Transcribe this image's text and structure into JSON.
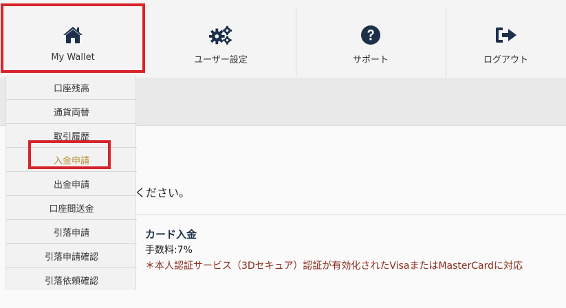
{
  "nav": {
    "items": [
      {
        "label": "My Wallet",
        "icon": "home-icon"
      },
      {
        "label": "ユーザー設定",
        "icon": "gears-icon"
      },
      {
        "label": "サポート",
        "icon": "question-icon"
      },
      {
        "label": "ログアウト",
        "icon": "logout-icon"
      }
    ]
  },
  "dropdown": {
    "items": [
      {
        "label": "口座残高"
      },
      {
        "label": "通貨両替"
      },
      {
        "label": "取引履歴"
      },
      {
        "label": "入金申請"
      },
      {
        "label": "出金申請"
      },
      {
        "label": "口座間送金"
      },
      {
        "label": "引落申請"
      },
      {
        "label": "引落申請確認"
      },
      {
        "label": "引落依頼確認"
      }
    ],
    "active_label": "入金申請"
  },
  "content": {
    "instruction_tail": "ください。",
    "card_title": "カード入金",
    "fee": "手数料:7%",
    "note": "＊本人認証サービス（3Dセキュア）認証が有効化されたVisaまたはMasterCardに対応"
  },
  "colors": {
    "highlight": "#d8232a",
    "active": "#b8892a",
    "navy": "#1d2f4a",
    "note": "#8b2a1c"
  }
}
